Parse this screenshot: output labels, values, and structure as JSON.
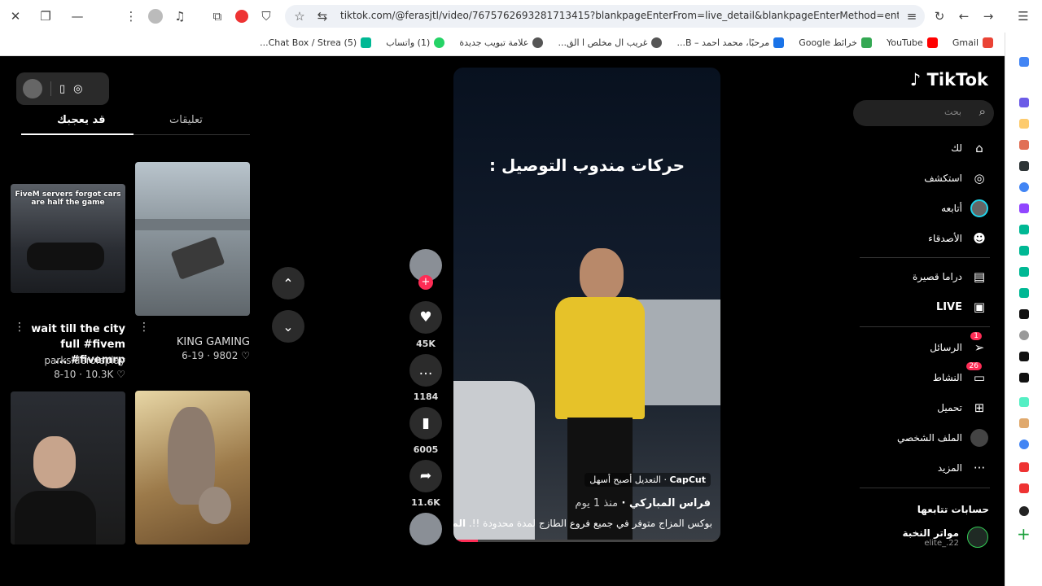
{
  "browser": {
    "url": "tiktok.com/@ferasjtl/video/7675762693281713415?blankpageEnterFrom=live_detail&blankpageEnterMethod=enter&enterMethod...",
    "bookmarks": [
      {
        "label": "Gmail",
        "color": "#ea4335"
      },
      {
        "label": "YouTube",
        "color": "#ff0000"
      },
      {
        "label": "خرائط Google",
        "color": "#34a853"
      },
      {
        "label": "مرحبًا، محمد احمد – B...",
        "color": "#1a73e8"
      },
      {
        "label": "غريب ال مخلص ا الق...",
        "color": "#555555"
      },
      {
        "label": "علامة تبويب جديدة",
        "color": "#555555"
      },
      {
        "label": "(1) واتساب",
        "color": "#25d366"
      },
      {
        "label": "(5) Chat Box / Strea...",
        "color": "#00b894"
      }
    ]
  },
  "left_panel": {
    "tab_active": "قد يعجبك",
    "tab_inactive": "تعليقات",
    "videos": [
      {
        "thumb_text": "FiveM servers forgot cars are half the game",
        "title": "wait till the city full #fivem #fivemrp ...",
        "author": "parksideroleplay",
        "date": "8-10",
        "likes": "10.3K"
      },
      {
        "title": "KING GAMING",
        "date": "6-19",
        "likes": "9802"
      }
    ]
  },
  "video": {
    "overlay_text": "حركات مندوب التوصيل :",
    "capcut_label": "CapCut",
    "capcut_text": "التعديل أصبح أسهل",
    "author": "فراس المباركي",
    "time": "منذ 1 يوم",
    "description": "بوكس المزاج متوفر في جميع فروع الطازج لمدة محدودة !!.",
    "more": "المزيد",
    "progress": 0.09
  },
  "actions": {
    "likes": "45K",
    "comments": "1184",
    "bookmarks": "6005",
    "shares": "11.6K"
  },
  "nav": {
    "logo": "TikTok",
    "search_placeholder": "بحث",
    "items": [
      "لك",
      "استكشف",
      "أتابعه",
      "الأصدقاء",
      "دراما قصيرة",
      "LIVE",
      "الرسائل",
      "النشاط",
      "تحميل",
      "الملف الشخصي",
      "المزيد"
    ],
    "messages_badge": "1",
    "activity_badge": "26",
    "following_header": "حسابات تتابعها",
    "following": [
      {
        "name": "مواتر النخبة",
        "handle": "elite_.22"
      }
    ]
  }
}
